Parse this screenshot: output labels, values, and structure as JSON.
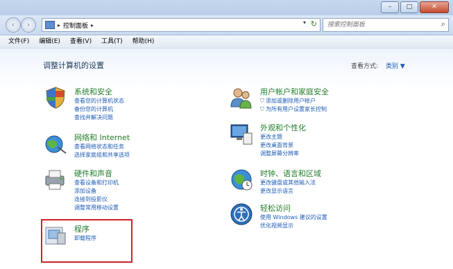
{
  "window": {
    "minimize": "–",
    "maximize": "□",
    "close": "✕"
  },
  "nav": {
    "back": "‹",
    "forward": "›"
  },
  "address": {
    "crumb": "控制面板",
    "sep1": "▸",
    "sep2": "▸",
    "dropdown": "▾",
    "refresh": "↻"
  },
  "search": {
    "placeholder": "搜索控制面板",
    "icon": "🔍"
  },
  "menu": [
    "文件(F)",
    "编辑(E)",
    "查看(V)",
    "工具(T)",
    "帮助(H)"
  ],
  "main": {
    "title": "调整计算机的设置",
    "view_by_label": "查看方式:",
    "view_by_value": "类别 ▼"
  },
  "categories": {
    "system": {
      "title": "系统和安全",
      "links": [
        "查看您的计算机状态",
        "备份您的计算机",
        "查找并解决问题"
      ]
    },
    "network": {
      "title": "网络和 Internet",
      "links": [
        "查看网络状态和任务",
        "选择家庭组和共享选项"
      ]
    },
    "hardware": {
      "title": "硬件和声音",
      "links": [
        "查看设备和打印机",
        "添加设备",
        "连接到投影仪",
        "调整常用移动设置"
      ]
    },
    "programs": {
      "title": "程序",
      "links": [
        "卸载程序"
      ]
    },
    "users": {
      "title": "用户帐户和家庭安全",
      "links": [
        "添加或删除用户帐户",
        "为所有用户设置家长控制"
      ]
    },
    "appearance": {
      "title": "外观和个性化",
      "links": [
        "更改主题",
        "更改桌面背景",
        "调整屏幕分辨率"
      ]
    },
    "clock": {
      "title": "时钟、语言和区域",
      "links": [
        "更改键盘或其他输入法",
        "更改显示语言"
      ]
    },
    "ease": {
      "title": "轻松访问",
      "links": [
        "使用 Windows 建议的设置",
        "优化视频显示"
      ]
    }
  }
}
